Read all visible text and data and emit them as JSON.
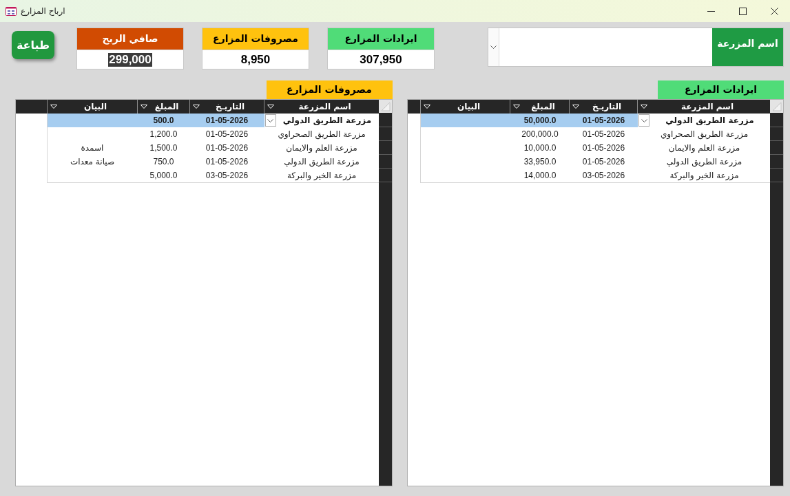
{
  "window": {
    "title": "ارباح المزارع"
  },
  "farm_filter": {
    "label": "اسم المزرعة"
  },
  "summary_cards": [
    {
      "title": "ايرادات المزارع",
      "value": "307,950",
      "color": "#50dc78",
      "value_highlighted": false
    },
    {
      "title": "مصروفات المزارع",
      "value": "8,950",
      "color": "#ffc20e",
      "value_highlighted": false
    },
    {
      "title": "صافي الربح",
      "value": "299,000",
      "color": "#d14b02",
      "value_highlighted": true
    }
  ],
  "print_button": {
    "label": "طباعة"
  },
  "panels": [
    {
      "title": "ايرادات المزارع",
      "color": "#50dc78",
      "columns": [
        "اسم المزرعة",
        "التاريـخ",
        "المبلغ",
        "البيان"
      ],
      "rows": [
        {
          "farm": "مزرعة الطريق الدولي",
          "date": "01-05-2026",
          "amount": "50,000.0",
          "selected": true
        },
        {
          "farm": "مزرعة الطريق الصحراوي",
          "date": "01-05-2026",
          "amount": "200,000.0",
          "selected": false
        },
        {
          "farm": "مزرعة العلم والايمان",
          "date": "01-05-2026",
          "amount": "10,000.0",
          "selected": false
        },
        {
          "farm": "مزرعة الطريق الدولي",
          "date": "01-05-2026",
          "amount": "33,950.0",
          "selected": false
        },
        {
          "farm": "مزرعة الخير والبركة",
          "date": "03-05-2026",
          "amount": "14,000.0",
          "selected": false
        }
      ]
    },
    {
      "title": "مصروفات المزارع",
      "color": "#ffc20e",
      "columns": [
        "اسم المزرعة",
        "التاريـخ",
        "المبلغ",
        "البيان"
      ],
      "rows": [
        {
          "farm": "مزرعة الطريق الدولي",
          "date": "01-05-2026",
          "amount": "500.0",
          "selected": true
        },
        {
          "farm": "مزرعة الطريق الصحراوي",
          "date": "01-05-2026",
          "amount": "1,200.0",
          "selected": false
        },
        {
          "farm": "مزرعة العلم والايمان",
          "date": "01-05-2026",
          "amount": "1,500.0",
          "note": "اسمدة",
          "selected": false
        },
        {
          "farm": "مزرعة الطريق الدولي",
          "date": "01-05-2026",
          "amount": "750.0",
          "note": "صيانة معدات",
          "selected": false
        },
        {
          "farm": "مزرعة الخير والبركة",
          "date": "03-05-2026",
          "amount": "5,000.0",
          "selected": false
        }
      ]
    }
  ]
}
